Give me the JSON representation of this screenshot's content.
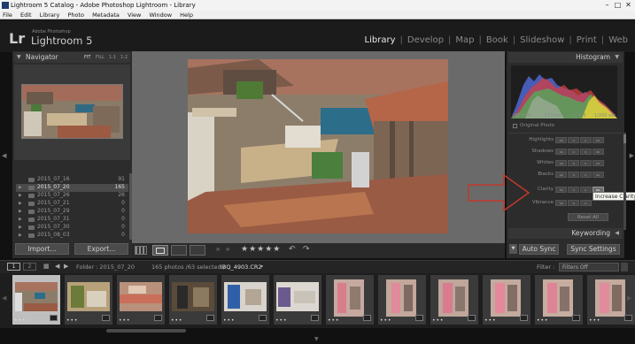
{
  "window": {
    "title": "Lightroom 5 Catalog - Adobe Photoshop Lightroom - Library",
    "minimize": "–",
    "maximize": "□",
    "close": "✕"
  },
  "menu": [
    "File",
    "Edit",
    "Library",
    "Photo",
    "Metadata",
    "View",
    "Window",
    "Help"
  ],
  "identity": {
    "logo": "Lr",
    "vendor": "Adobe Photoshop",
    "product": "Lightroom 5"
  },
  "modules": [
    "Library",
    "Develop",
    "Map",
    "Book",
    "Slideshow",
    "Print",
    "Web"
  ],
  "active_module": "Library",
  "navigator": {
    "title": "Navigator",
    "zoom_options": [
      "FIT",
      "FILL",
      "1:1",
      "1:2"
    ]
  },
  "folders": [
    {
      "name": "2015_07_16",
      "count": "91",
      "selected": false
    },
    {
      "name": "2015_07_20",
      "count": "165",
      "selected": true
    },
    {
      "name": "2015_07_26",
      "count": "26",
      "selected": false
    },
    {
      "name": "2015_07_21",
      "count": "0",
      "selected": false
    },
    {
      "name": "2015_07_29",
      "count": "0",
      "selected": false
    },
    {
      "name": "2015_07_31",
      "count": "0",
      "selected": false
    },
    {
      "name": "2015_07_30",
      "count": "0",
      "selected": false
    },
    {
      "name": "2015_08_03",
      "count": "0",
      "selected": false
    }
  ],
  "left_buttons": {
    "import": "Import...",
    "export": "Export..."
  },
  "toolbar": {
    "stars": "★★★★★"
  },
  "histogram": {
    "title": "Histogram",
    "iso": "ISO 640",
    "focal": "113 mm",
    "aperture": "f / 6.3",
    "shutter": "1/200 sec",
    "original_photo_label": "Original Photo"
  },
  "quick_develop": {
    "rows": [
      "Highlights",
      "Shadows",
      "Whites",
      "Blacks",
      "Clarity",
      "Vibrance"
    ],
    "reset_all": "Reset All",
    "tooltip": "Increase Clarity"
  },
  "keywording": {
    "title": "Keywording"
  },
  "sync": {
    "auto_sync": "Auto Sync",
    "sync_settings": "Sync Settings"
  },
  "filmstrip_bar": {
    "page1": "1",
    "page2": "2",
    "source": "Folder : 2015_07_20",
    "count_text": "165 photos /63 selected /",
    "filename": "IBQ_4903.CR2",
    "filter_label": "Filter :",
    "filter_value": "Filters Off"
  },
  "filmstrip_dots": "• • •",
  "colors": {
    "accent_red": "#c0392b",
    "active_text": "#e8e8e8"
  }
}
